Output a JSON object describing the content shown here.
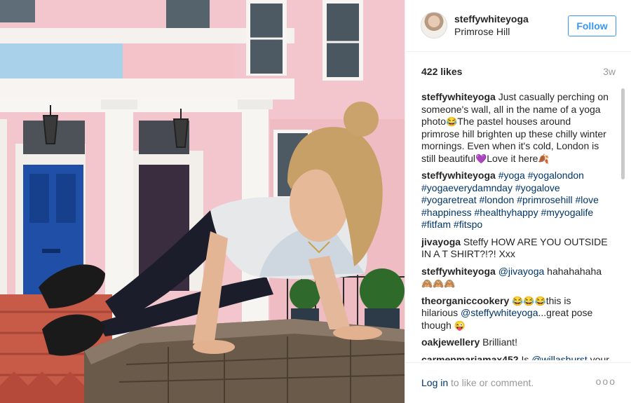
{
  "post": {
    "username": "steffywhiteyoga",
    "location": "Primrose Hill",
    "follow_label": "Follow",
    "likes": "422 likes",
    "time_ago": "3w"
  },
  "comments": [
    {
      "user": "steffywhiteyoga",
      "parts": [
        {
          "text": "Just casually perching on someone's wall, all in the name of a yoga photo"
        },
        {
          "emoji": "😂"
        },
        {
          "text": "The pastel houses around primrose hill brighten up these chilly winter mornings. Even when it's cold, London is still beautiful"
        },
        {
          "emoji": "💜"
        },
        {
          "text": "Love it here"
        },
        {
          "emoji": "🍂"
        }
      ]
    },
    {
      "user": "steffywhiteyoga",
      "parts": [
        {
          "tag": "#yoga"
        },
        {
          "text": " "
        },
        {
          "tag": "#yogalondon"
        },
        {
          "text": " "
        },
        {
          "tag": "#yogaeverydamnday"
        },
        {
          "text": " "
        },
        {
          "tag": "#yogalove"
        },
        {
          "text": " "
        },
        {
          "tag": "#yogaretreat"
        },
        {
          "text": " "
        },
        {
          "tag": "#london"
        },
        {
          "text": " "
        },
        {
          "tag": "#primrosehill"
        },
        {
          "text": " "
        },
        {
          "tag": "#love"
        },
        {
          "text": " "
        },
        {
          "tag": "#happiness"
        },
        {
          "text": " "
        },
        {
          "tag": "#healthyhappy"
        },
        {
          "text": " "
        },
        {
          "tag": "#myyogalife"
        },
        {
          "text": " "
        },
        {
          "tag": "#fitfam"
        },
        {
          "text": " "
        },
        {
          "tag": "#fitspo"
        }
      ]
    },
    {
      "user": "jivayoga",
      "parts": [
        {
          "text": "Steffy HOW ARE YOU OUTSIDE IN A T SHIRT?!?! Xxx"
        }
      ]
    },
    {
      "user": "steffywhiteyoga",
      "parts": [
        {
          "tag": "@jivayoga"
        },
        {
          "text": " hahahahaha "
        },
        {
          "emoji": "🙈🙈🙈"
        }
      ]
    },
    {
      "user": "theorganiccookery",
      "parts": [
        {
          "emoji": "😂😂😂"
        },
        {
          "text": "this is hilarious "
        },
        {
          "tag": "@steffywhiteyoga"
        },
        {
          "text": "...great pose though "
        },
        {
          "emoji": "😜"
        }
      ]
    },
    {
      "user": "oakjewellery",
      "parts": [
        {
          "text": "Brilliant!"
        }
      ]
    },
    {
      "user": "carmenmariamax452",
      "parts": [
        {
          "text": "Is "
        },
        {
          "tag": "@willashurst"
        },
        {
          "text": " your "
        },
        {
          "emoji": "🙈🙈🙈"
        }
      ]
    }
  ],
  "footer": {
    "login_link": "Log in",
    "login_suffix": " to like or comment.",
    "more_label": "ooo"
  },
  "icons": {
    "avatar": "profile-avatar",
    "more": "more-options-icon"
  }
}
